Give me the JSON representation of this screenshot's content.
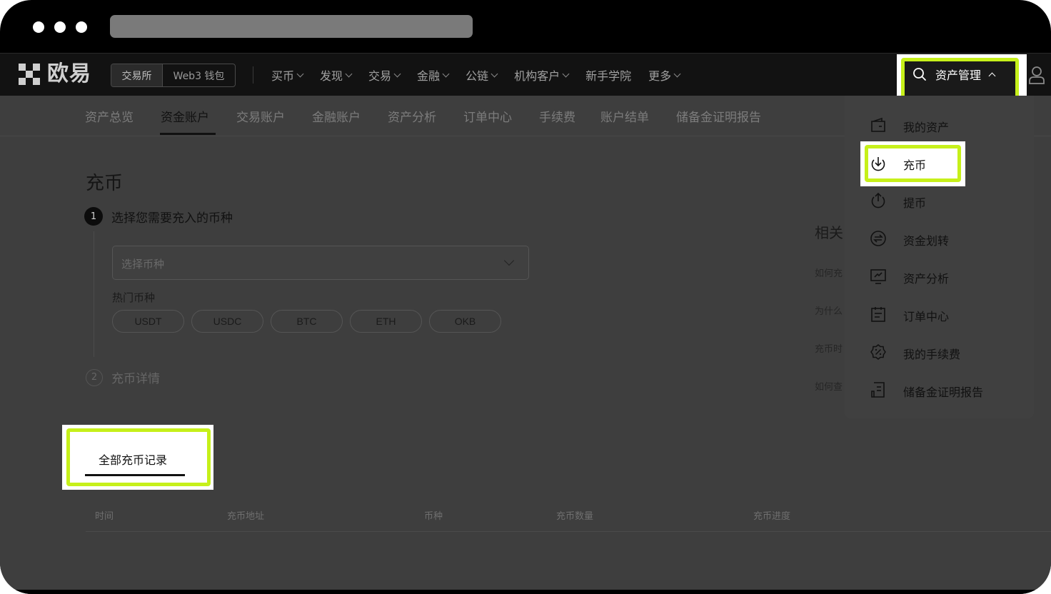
{
  "brand": {
    "name": "欧易"
  },
  "mode_switch": {
    "exchange": "交易所",
    "wallet": "Web3 钱包"
  },
  "top_menu": [
    {
      "label": "买币"
    },
    {
      "label": "发现"
    },
    {
      "label": "交易"
    },
    {
      "label": "金融"
    },
    {
      "label": "公链"
    },
    {
      "label": "机构客户"
    },
    {
      "label": "新手学院"
    },
    {
      "label": "更多"
    }
  ],
  "asset_menu": {
    "label": "资产管理"
  },
  "sub_nav": [
    {
      "label": "资产总览"
    },
    {
      "label": "资金账户"
    },
    {
      "label": "交易账户"
    },
    {
      "label": "金融账户"
    },
    {
      "label": "资产分析"
    },
    {
      "label": "订单中心"
    },
    {
      "label": "手续费"
    },
    {
      "label": "账户结单"
    },
    {
      "label": "储备金证明报告"
    }
  ],
  "page": {
    "title": "充币",
    "step1_num": "1",
    "step1_label": "选择您需要充入的币种",
    "select_placeholder": "选择币种",
    "hot_label": "热门币种",
    "hot_coins": [
      "USDT",
      "USDC",
      "BTC",
      "ETH",
      "OKB"
    ],
    "step2_num": "2",
    "step2_label": "充币详情",
    "records_tab": "全部充币记录",
    "table_headers": [
      "时间",
      "充币地址",
      "币种",
      "充币数量",
      "充币进度"
    ]
  },
  "faq": {
    "title": "相关",
    "items": [
      "如何充",
      "为什么",
      "充币时",
      "如何查"
    ]
  },
  "dropdown": {
    "items": [
      {
        "label": "我的资产",
        "icon": "wallet-icon"
      },
      {
        "label": "充币",
        "icon": "deposit-icon"
      },
      {
        "label": "提币",
        "icon": "withdraw-icon"
      },
      {
        "label": "资金划转",
        "icon": "transfer-icon"
      },
      {
        "label": "资产分析",
        "icon": "analysis-icon"
      },
      {
        "label": "订单中心",
        "icon": "order-icon"
      },
      {
        "label": "我的手续费",
        "icon": "fee-icon"
      },
      {
        "label": "储备金证明报告",
        "icon": "report-icon"
      }
    ]
  },
  "colors": {
    "highlight": "#c6f01a",
    "overlay": "#3e3e3e",
    "nav": "#121212"
  }
}
